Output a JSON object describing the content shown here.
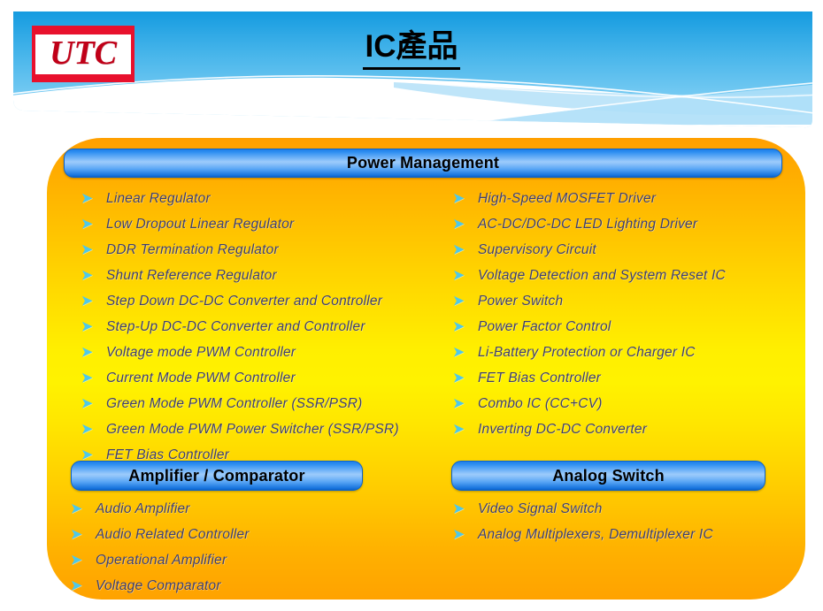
{
  "header": {
    "logo_text": "UTC",
    "logo_name": "utc-logo",
    "title": "IC產品",
    "banner_color": "#2FA6E8",
    "banner_color_light": "#8FD4F6"
  },
  "panel": {
    "gradient_top": "#FF9F00",
    "gradient_mid": "#FFF200",
    "gradient_bottom": "#FFA200"
  },
  "sections": [
    {
      "id": "power-management",
      "title": "Power Management",
      "columns": [
        {
          "items": [
            "Linear  Regulator",
            "Low Dropout Linear Regulator",
            "DDR  Termination Regulator",
            "Shunt Reference Regulator",
            "Step Down DC-DC Converter and Controller",
            "Step-Up DC-DC Converter and Controller",
            "Voltage mode PWM Controller",
            "Current Mode PWM Controller",
            "Green Mode PWM Controller (SSR/PSR)",
            "Green Mode PWM Power Switcher (SSR/PSR)",
            "FET Bias Controller"
          ]
        },
        {
          "items": [
            "High-Speed MOSFET Driver",
            "AC-DC/DC-DC LED Lighting Driver",
            "Supervisory Circuit",
            "Voltage Detection and System Reset IC",
            "Power Switch",
            "Power Factor Control",
            "Li-Battery Protection or Charger IC",
            "FET Bias Controller",
            "Combo IC (CC+CV)",
            "Inverting DC-DC Converter"
          ]
        }
      ]
    },
    {
      "id": "amplifier-comparator",
      "title": "Amplifier / Comparator",
      "columns": [
        {
          "items": [
            "Audio Amplifier",
            "Audio Related Controller",
            "Operational Amplifier",
            "Voltage Comparator"
          ]
        }
      ]
    },
    {
      "id": "analog-switch",
      "title": "Analog Switch",
      "columns": [
        {
          "items": [
            "Video Signal Switch",
            " Analog Multiplexers, Demultiplexer IC"
          ]
        }
      ]
    }
  ],
  "bullet_glyph": "➤",
  "colors": {
    "bullet": "#4FC8E8",
    "list_text": "#3F3F6E",
    "section_bar_blue": "#2F8FF2",
    "logo_red": "#E8112D"
  }
}
